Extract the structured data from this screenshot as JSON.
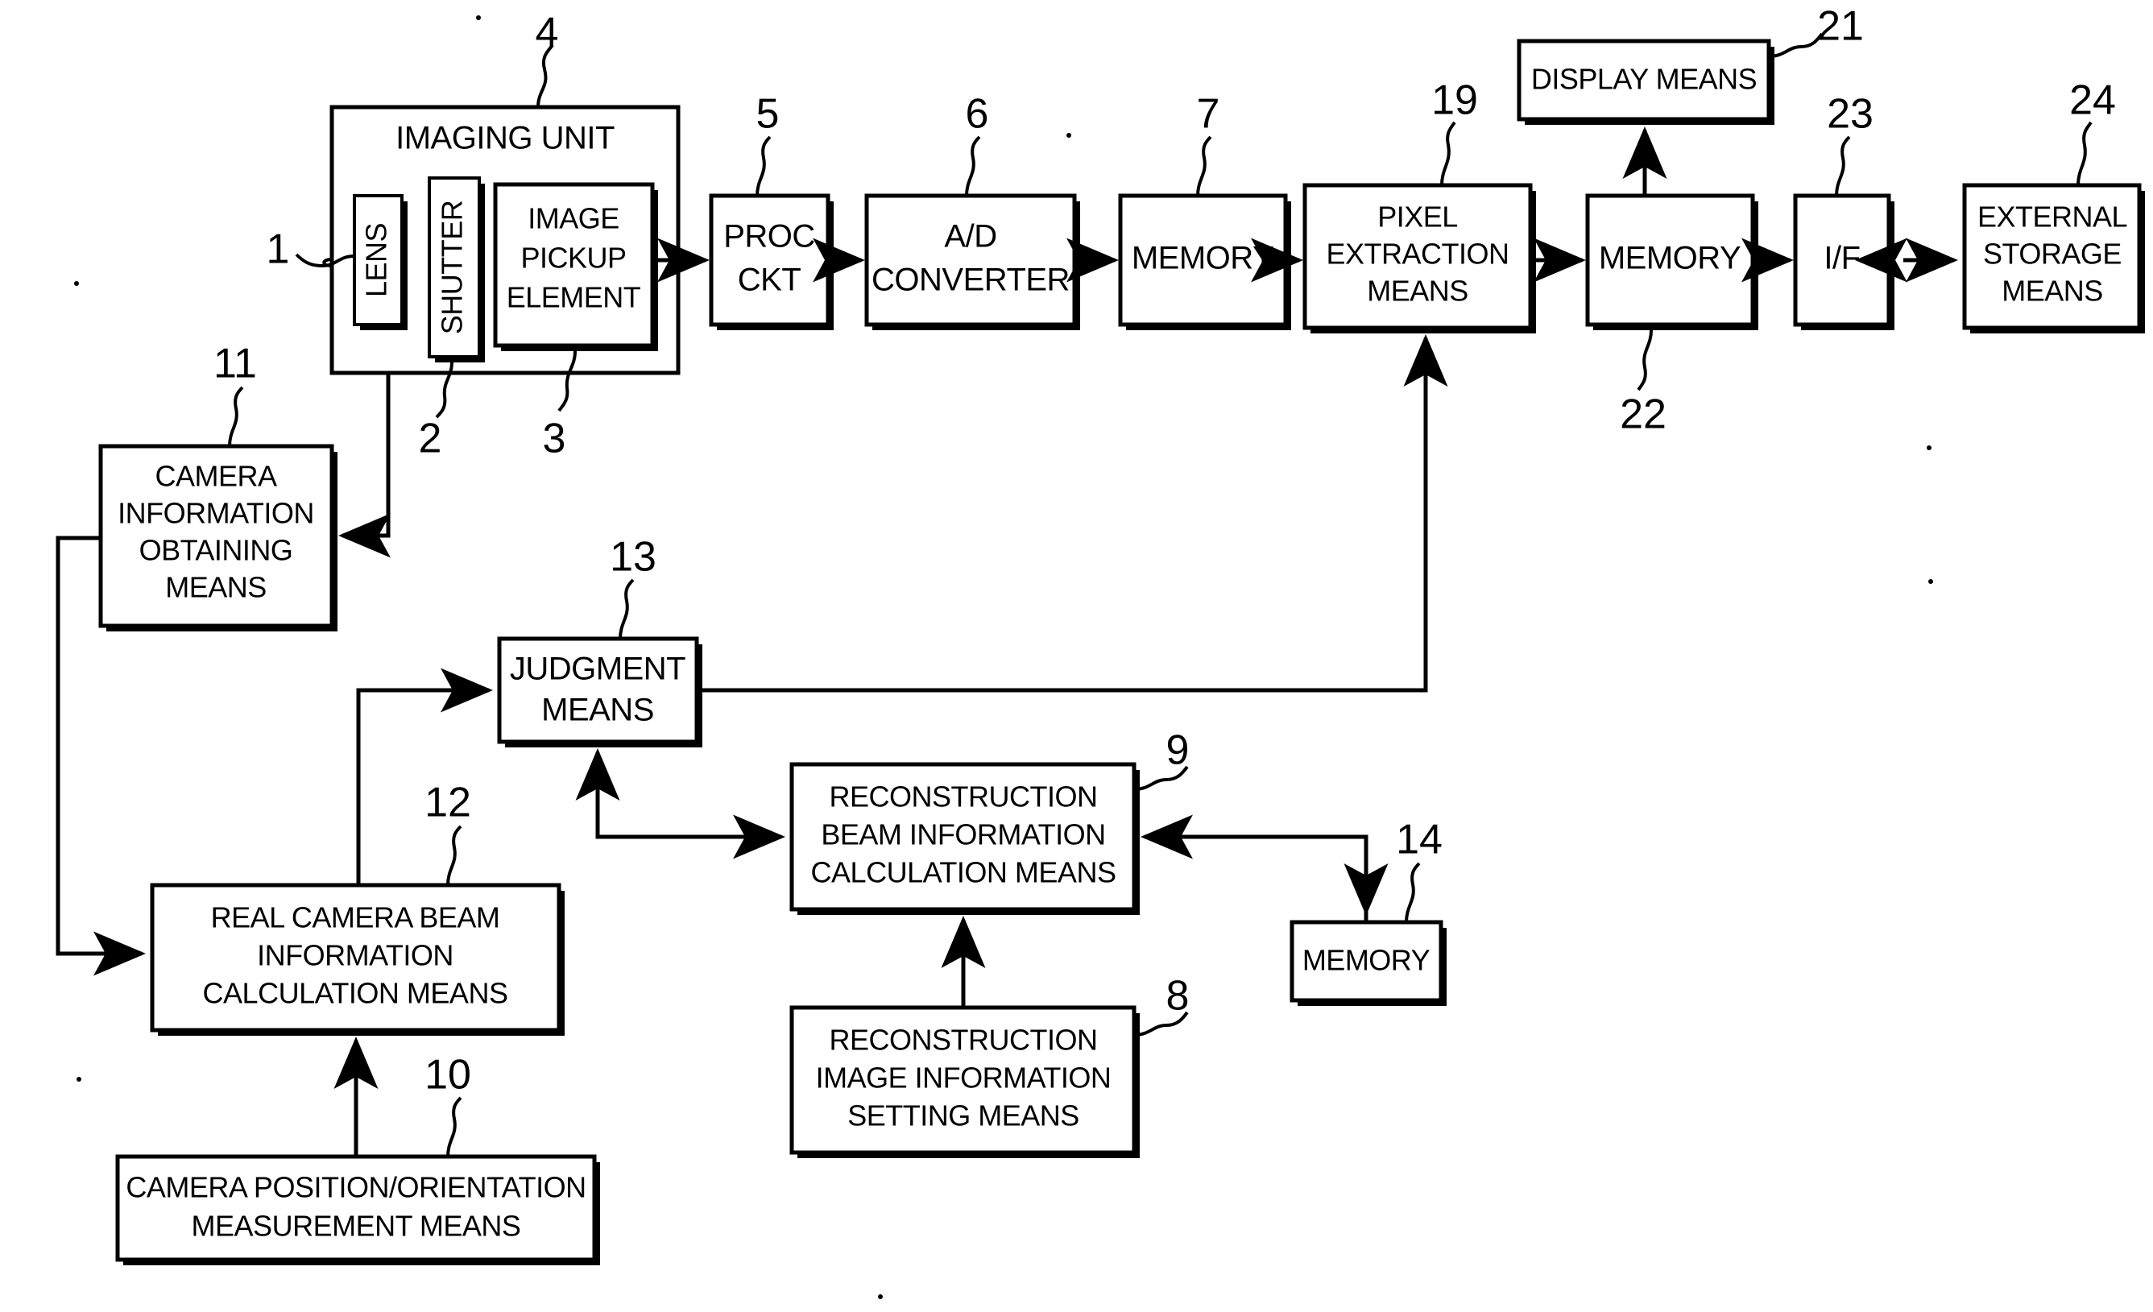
{
  "figure": {
    "type": "patent-block-diagram",
    "background_color": "#ffffff",
    "line_color": "#000000"
  },
  "blocks": {
    "imaging_unit": {
      "label": "IMAGING UNIT",
      "ref": "4"
    },
    "lens": {
      "label": "LENS",
      "ref": "1",
      "orientation": "vertical"
    },
    "shutter": {
      "label": "SHUTTER",
      "ref": "2",
      "orientation": "vertical"
    },
    "image_pickup_element": {
      "label_line1": "IMAGE",
      "label_line2": "PICKUP",
      "label_line3": "ELEMENT",
      "ref": "3"
    },
    "proc_ckt": {
      "label_line1": "PROC",
      "label_line2": "CKT",
      "ref": "5"
    },
    "ad_converter": {
      "label_line1": "A/D",
      "label_line2": "CONVERTER",
      "ref": "6"
    },
    "memory_7": {
      "label": "MEMORY",
      "ref": "7"
    },
    "pixel_extraction_means": {
      "label_line1": "PIXEL",
      "label_line2": "EXTRACTION",
      "label_line3": "MEANS",
      "ref": "19"
    },
    "display_means": {
      "label": "DISPLAY MEANS",
      "ref": "21"
    },
    "memory_22": {
      "label": "MEMORY",
      "ref": "22"
    },
    "interface": {
      "label": "I/F",
      "ref": "23"
    },
    "external_storage_means": {
      "label_line1": "EXTERNAL",
      "label_line2": "STORAGE",
      "label_line3": "MEANS",
      "ref": "24"
    },
    "camera_information_obtaining_means": {
      "label_line1": "CAMERA",
      "label_line2": "INFORMATION",
      "label_line3": "OBTAINING",
      "label_line4": "MEANS",
      "ref": "11"
    },
    "judgment_means": {
      "label_line1": "JUDGMENT",
      "label_line2": "MEANS",
      "ref": "13"
    },
    "reconstruction_beam_information_calculation_means": {
      "label_line1": "RECONSTRUCTION",
      "label_line2": "BEAM INFORMATION",
      "label_line3": "CALCULATION MEANS",
      "ref": "9"
    },
    "memory_14": {
      "label": "MEMORY",
      "ref": "14"
    },
    "real_camera_beam_information_calculation_means": {
      "label_line1": "REAL CAMERA BEAM",
      "label_line2": "INFORMATION",
      "label_line3": "CALCULATION MEANS",
      "ref": "12"
    },
    "reconstruction_image_information_setting_means": {
      "label_line1": "RECONSTRUCTION",
      "label_line2": "IMAGE INFORMATION",
      "label_line3": "SETTING MEANS",
      "ref": "8"
    },
    "camera_position_orientation_measurement_means": {
      "label_line1": "CAMERA POSITION/ORIENTATION",
      "label_line2": "MEASUREMENT MEANS",
      "ref": "10"
    }
  },
  "reference_numerals": [
    "1",
    "2",
    "3",
    "4",
    "5",
    "6",
    "7",
    "8",
    "9",
    "10",
    "11",
    "12",
    "13",
    "14",
    "19",
    "21",
    "22",
    "23",
    "24"
  ],
  "connections": [
    {
      "from": "lens",
      "to": "shutter",
      "style": "plain"
    },
    {
      "from": "image_pickup_element",
      "to": "proc_ckt",
      "style": "arrow"
    },
    {
      "from": "proc_ckt",
      "to": "ad_converter",
      "style": "arrow"
    },
    {
      "from": "ad_converter",
      "to": "memory_7",
      "style": "arrow"
    },
    {
      "from": "memory_7",
      "to": "pixel_extraction_means",
      "style": "arrow"
    },
    {
      "from": "pixel_extraction_means",
      "to": "memory_22",
      "style": "arrow"
    },
    {
      "from": "memory_22",
      "to": "display_means",
      "style": "arrow"
    },
    {
      "from": "memory_22",
      "to": "interface",
      "style": "arrow"
    },
    {
      "from": "interface",
      "to": "external_storage_means",
      "style": "double-arrow"
    },
    {
      "from": "imaging_unit",
      "to": "camera_information_obtaining_means",
      "style": "arrow"
    },
    {
      "from": "camera_information_obtaining_means",
      "to": "real_camera_beam_information_calculation_means",
      "style": "arrow"
    },
    {
      "from": "camera_position_orientation_measurement_means",
      "to": "real_camera_beam_information_calculation_means",
      "style": "arrow"
    },
    {
      "from": "real_camera_beam_information_calculation_means",
      "to": "judgment_means",
      "style": "arrow"
    },
    {
      "from": "reconstruction_beam_information_calculation_means",
      "to": "judgment_means",
      "style": "arrow"
    },
    {
      "from": "judgment_means",
      "to": "pixel_extraction_means",
      "style": "arrow"
    },
    {
      "from": "reconstruction_image_information_setting_means",
      "to": "reconstruction_beam_information_calculation_means",
      "style": "arrow"
    },
    {
      "from": "reconstruction_beam_information_calculation_means",
      "to": "memory_14",
      "style": "arrow"
    },
    {
      "from": "memory_14",
      "to": "reconstruction_beam_information_calculation_means",
      "style": "arrow"
    }
  ]
}
